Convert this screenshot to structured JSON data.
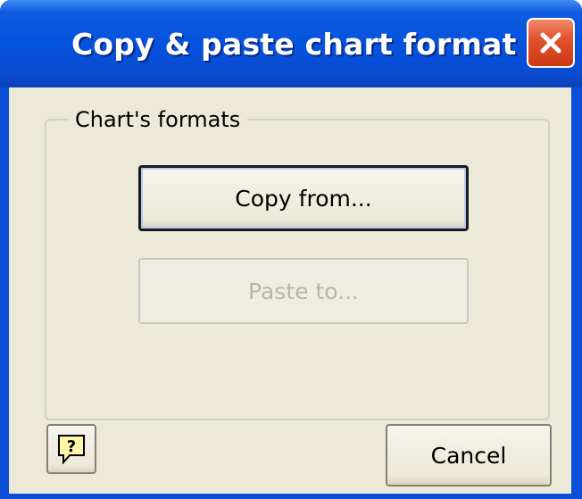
{
  "window": {
    "title": "Copy & paste chart format"
  },
  "group": {
    "legend": "Chart's formats"
  },
  "buttons": {
    "copy_from": "Copy from...",
    "paste_to": "Paste to...",
    "cancel": "Cancel"
  },
  "icons": {
    "close": "close-icon",
    "help": "help-icon"
  },
  "colors": {
    "titlebar": "#0553de",
    "close_button": "#e2532f",
    "dialog_face": "#ece9d8",
    "disabled_text": "#b8b7a5"
  }
}
